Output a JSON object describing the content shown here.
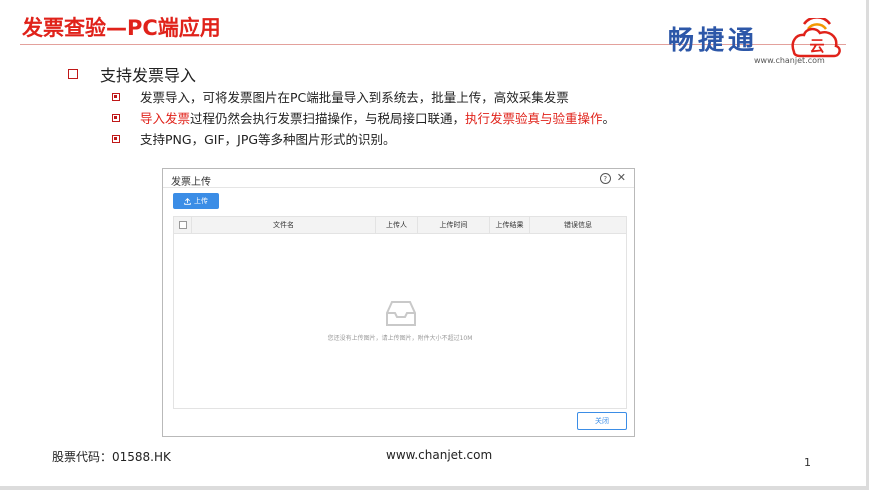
{
  "slide": {
    "title": "发票查验—PC端应用",
    "logo": {
      "text": "畅捷通",
      "cloud_char": "云",
      "url": "www.chanjet.com",
      "colors": [
        "#2d57a8",
        "#e0221a",
        "#f39800"
      ]
    },
    "main_bullet": "支持发票导入",
    "sub_bullets": [
      {
        "parts": [
          {
            "text": "发票导入，可将发票图片在PC端批量导入到系统去，批量上传，高效采集发票",
            "red": false
          }
        ]
      },
      {
        "parts": [
          {
            "text": "导入发票",
            "red": true
          },
          {
            "text": "过程仍然会执行发票扫描操作，与税局接口联通，",
            "red": false
          },
          {
            "text": "执行发票验真与验重操作",
            "red": true
          },
          {
            "text": "。",
            "red": false
          }
        ]
      },
      {
        "parts": [
          {
            "text": "支持PNG，GIF，JPG等多种图片形式的识别。",
            "red": false
          }
        ]
      }
    ],
    "footer": {
      "stock_code": "股票代码：01588.HK",
      "website": "www.chanjet.com",
      "page": "1"
    }
  },
  "dialog": {
    "title": "发票上传",
    "help_icon": "?",
    "close_icon": "✕",
    "upload_button": "上传",
    "columns": [
      "",
      "文件名",
      "上传人",
      "上传时间",
      "上传结果",
      "错误信息"
    ],
    "empty_text": "您还没有上传图片，请上传图片，附件大小不超过10M",
    "close_button": "关闭",
    "accent_color": "#3b8de6"
  }
}
